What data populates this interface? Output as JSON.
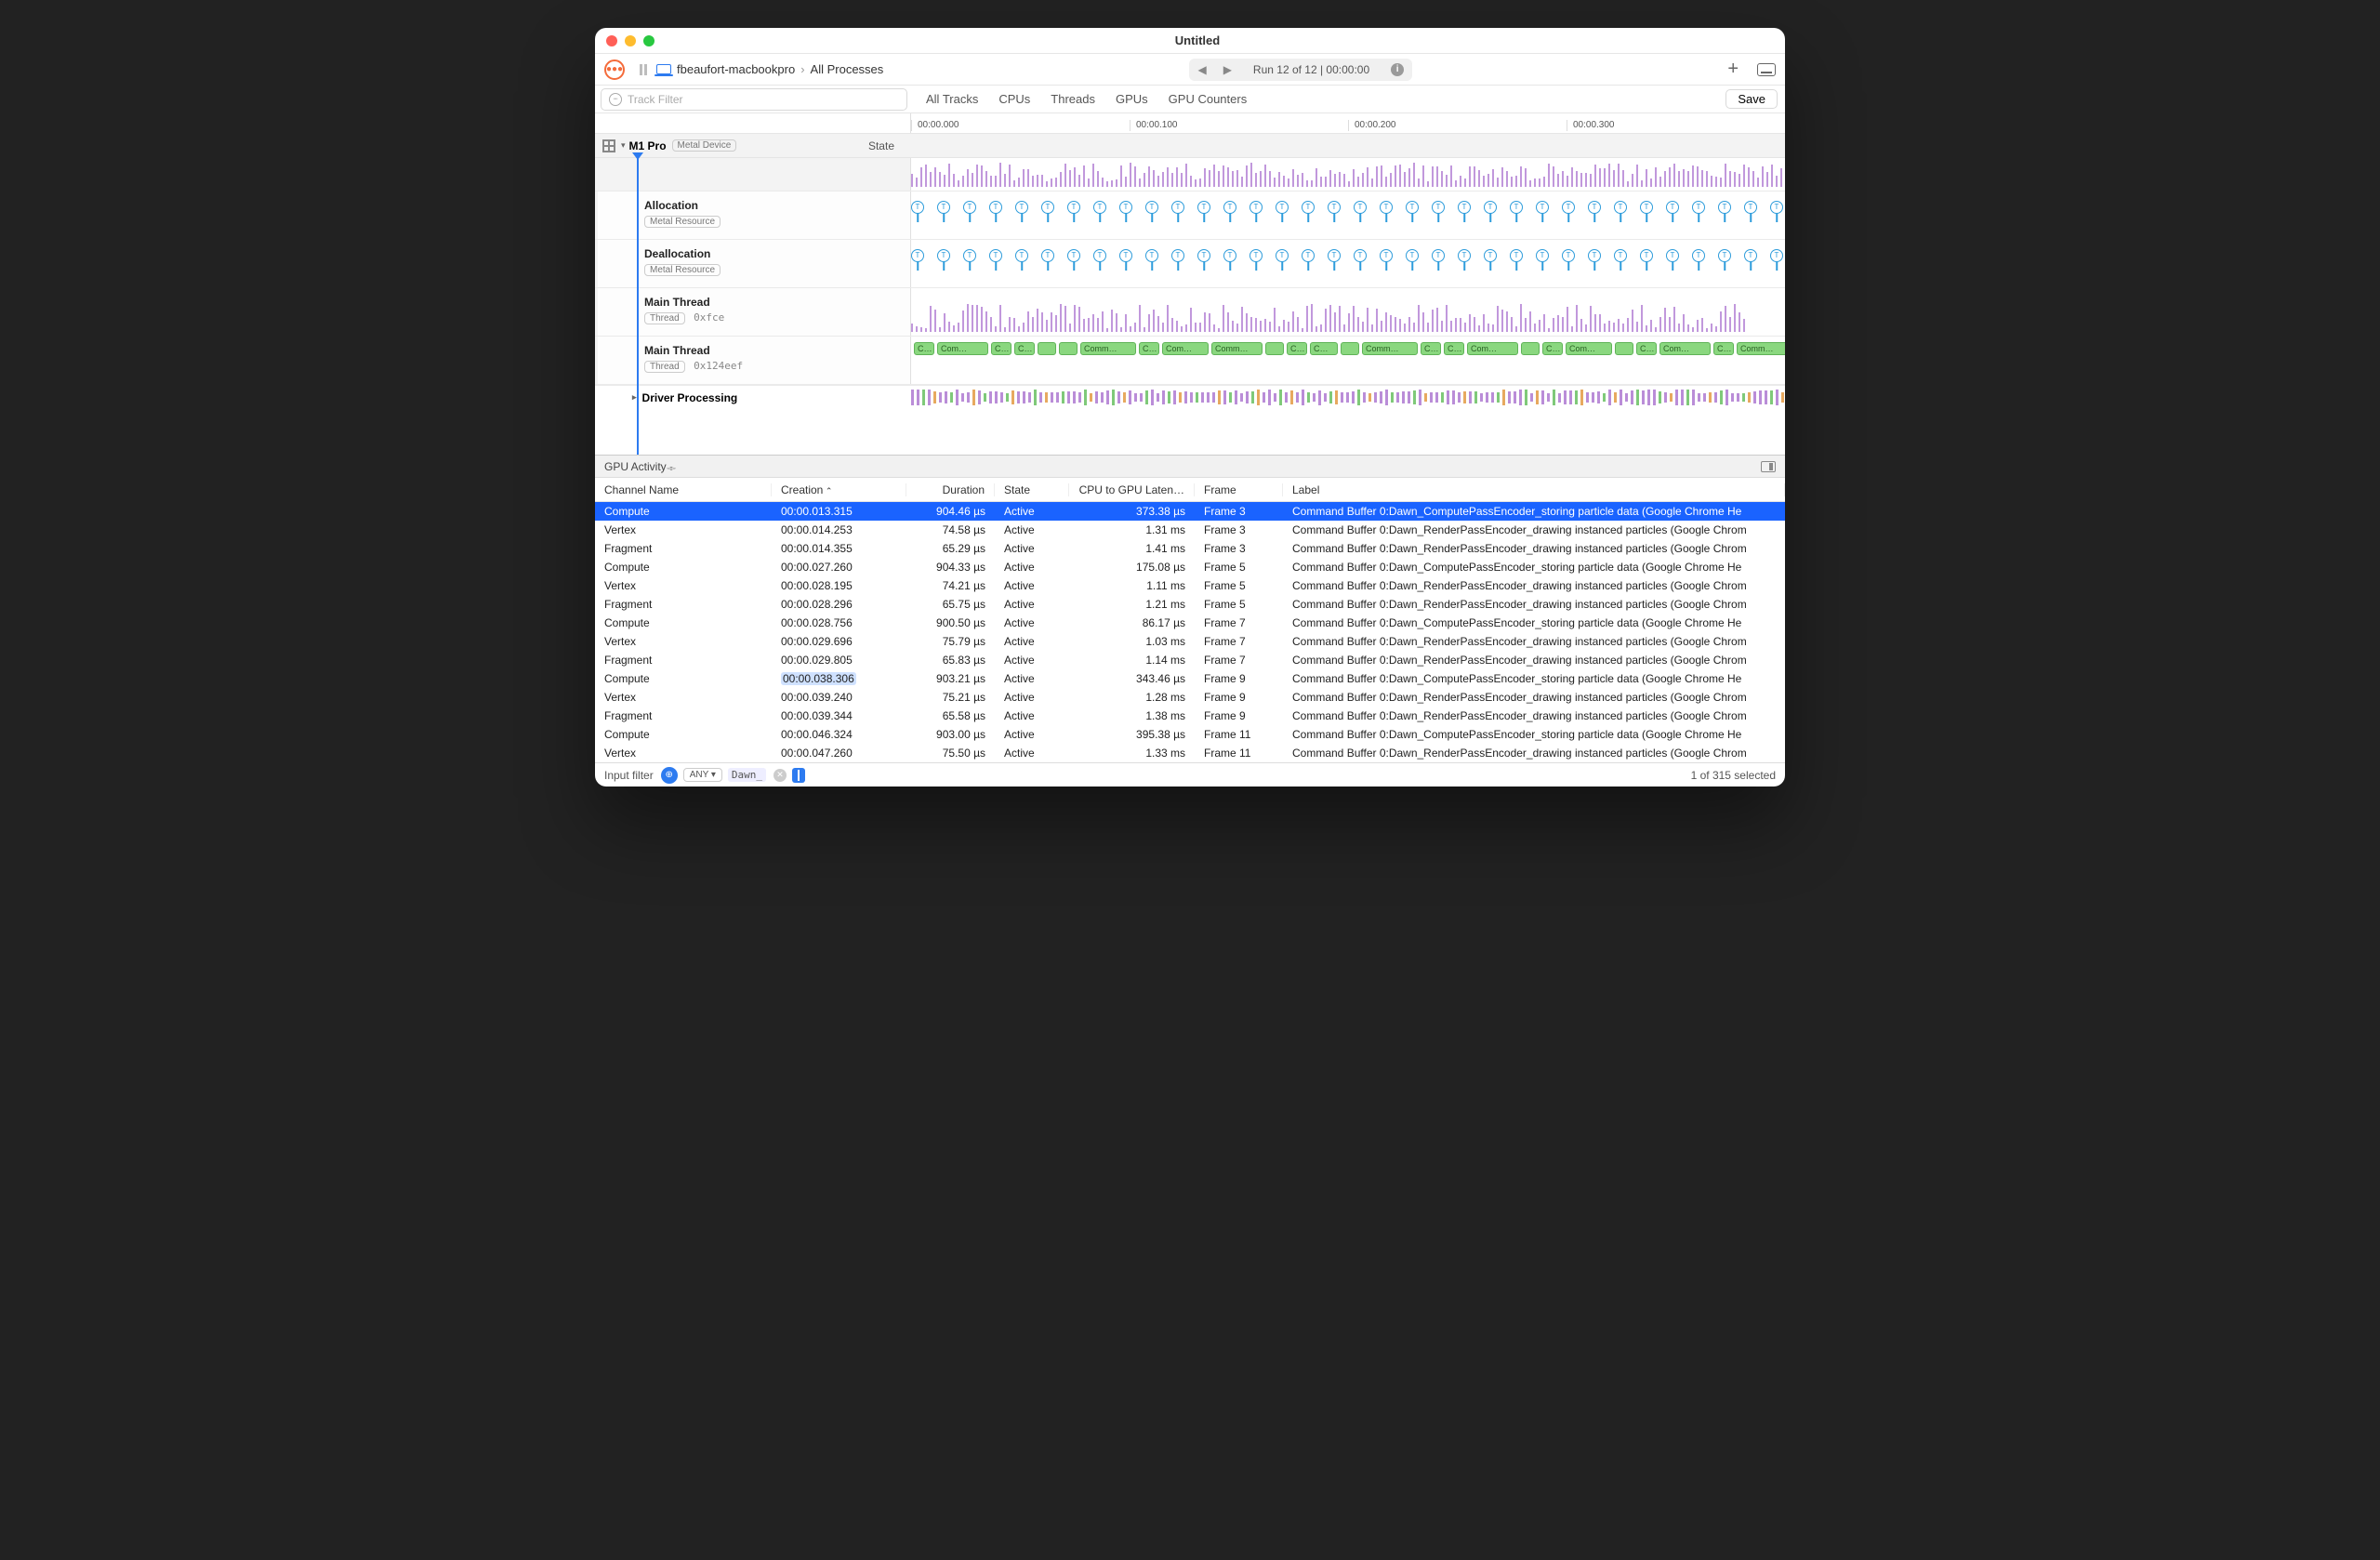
{
  "window": {
    "title": "Untitled"
  },
  "toolbar": {
    "machine": "fbeaufort-macbookpro",
    "crumb2": "All Processes",
    "run_text": "Run 12 of 12  |  00:00:00"
  },
  "filterbar": {
    "track_filter_placeholder": "Track Filter",
    "tabs": [
      "All Tracks",
      "CPUs",
      "Threads",
      "GPUs",
      "GPU Counters"
    ],
    "save": "Save"
  },
  "ruler": [
    "00:00.000",
    "00:00.100",
    "00:00.200",
    "00:00.300"
  ],
  "left": {
    "root": "M1 Pro",
    "root_pill": "Metal Device",
    "state": "State",
    "tracks": [
      {
        "name": "Allocation",
        "pill": "Metal Resource"
      },
      {
        "name": "Deallocation",
        "pill": "Metal Resource"
      },
      {
        "name": "Main Thread",
        "pill": "Thread",
        "hex": "0xfce"
      },
      {
        "name": "Main Thread",
        "pill": "Thread",
        "hex": "0x124eef"
      }
    ],
    "driver": "Driver Processing"
  },
  "panel": {
    "dropdown": "GPU Activity",
    "cols": {
      "ch": "Channel Name",
      "cr": "Creation",
      "du": "Duration",
      "st": "State",
      "la": "CPU to GPU Laten…",
      "fr": "Frame",
      "lb": "Label"
    },
    "rows": [
      {
        "ch": "Compute",
        "cr": "00:00.013.315",
        "du": "904.46 µs",
        "st": "Active",
        "la": "373.38 µs",
        "fr": "Frame 3",
        "lb": "Command Buffer 0:Dawn_ComputePassEncoder_storing particle data   (Google Chrome He",
        "sel": true
      },
      {
        "ch": "Vertex",
        "cr": "00:00.014.253",
        "du": "74.58 µs",
        "st": "Active",
        "la": "1.31 ms",
        "fr": "Frame 3",
        "lb": "Command Buffer 0:Dawn_RenderPassEncoder_drawing instanced particles   (Google Chrom"
      },
      {
        "ch": "Fragment",
        "cr": "00:00.014.355",
        "du": "65.29 µs",
        "st": "Active",
        "la": "1.41 ms",
        "fr": "Frame 3",
        "lb": "Command Buffer 0:Dawn_RenderPassEncoder_drawing instanced particles   (Google Chrom"
      },
      {
        "ch": "Compute",
        "cr": "00:00.027.260",
        "du": "904.33 µs",
        "st": "Active",
        "la": "175.08 µs",
        "fr": "Frame 5",
        "lb": "Command Buffer 0:Dawn_ComputePassEncoder_storing particle data   (Google Chrome He"
      },
      {
        "ch": "Vertex",
        "cr": "00:00.028.195",
        "du": "74.21 µs",
        "st": "Active",
        "la": "1.11 ms",
        "fr": "Frame 5",
        "lb": "Command Buffer 0:Dawn_RenderPassEncoder_drawing instanced particles   (Google Chrom"
      },
      {
        "ch": "Fragment",
        "cr": "00:00.028.296",
        "du": "65.75 µs",
        "st": "Active",
        "la": "1.21 ms",
        "fr": "Frame 5",
        "lb": "Command Buffer 0:Dawn_RenderPassEncoder_drawing instanced particles   (Google Chrom"
      },
      {
        "ch": "Compute",
        "cr": "00:00.028.756",
        "du": "900.50 µs",
        "st": "Active",
        "la": "86.17 µs",
        "fr": "Frame 7",
        "lb": "Command Buffer 0:Dawn_ComputePassEncoder_storing particle data   (Google Chrome He"
      },
      {
        "ch": "Vertex",
        "cr": "00:00.029.696",
        "du": "75.79 µs",
        "st": "Active",
        "la": "1.03 ms",
        "fr": "Frame 7",
        "lb": "Command Buffer 0:Dawn_RenderPassEncoder_drawing instanced particles   (Google Chrom"
      },
      {
        "ch": "Fragment",
        "cr": "00:00.029.805",
        "du": "65.83 µs",
        "st": "Active",
        "la": "1.14 ms",
        "fr": "Frame 7",
        "lb": "Command Buffer 0:Dawn_RenderPassEncoder_drawing instanced particles   (Google Chrom"
      },
      {
        "ch": "Compute",
        "cr": "00:00.038.306",
        "du": "903.21 µs",
        "st": "Active",
        "la": "343.46 µs",
        "fr": "Frame 9",
        "lb": "Command Buffer 0:Dawn_ComputePassEncoder_storing particle data   (Google Chrome He",
        "hl": true
      },
      {
        "ch": "Vertex",
        "cr": "00:00.039.240",
        "du": "75.21 µs",
        "st": "Active",
        "la": "1.28 ms",
        "fr": "Frame 9",
        "lb": "Command Buffer 0:Dawn_RenderPassEncoder_drawing instanced particles   (Google Chrom"
      },
      {
        "ch": "Fragment",
        "cr": "00:00.039.344",
        "du": "65.58 µs",
        "st": "Active",
        "la": "1.38 ms",
        "fr": "Frame 9",
        "lb": "Command Buffer 0:Dawn_RenderPassEncoder_drawing instanced particles   (Google Chrom"
      },
      {
        "ch": "Compute",
        "cr": "00:00.046.324",
        "du": "903.00 µs",
        "st": "Active",
        "la": "395.38 µs",
        "fr": "Frame 11",
        "lb": "Command Buffer 0:Dawn_ComputePassEncoder_storing particle data   (Google Chrome He"
      },
      {
        "ch": "Vertex",
        "cr": "00:00.047.260",
        "du": "75.50 µs",
        "st": "Active",
        "la": "1.33 ms",
        "fr": "Frame 11",
        "lb": "Command Buffer 0:Dawn_RenderPassEncoder_drawing instanced particles   (Google Chrom"
      }
    ]
  },
  "footer": {
    "label": "Input filter",
    "any": "ANY",
    "chip": "Dawn_",
    "count": "1 of 315 selected"
  }
}
